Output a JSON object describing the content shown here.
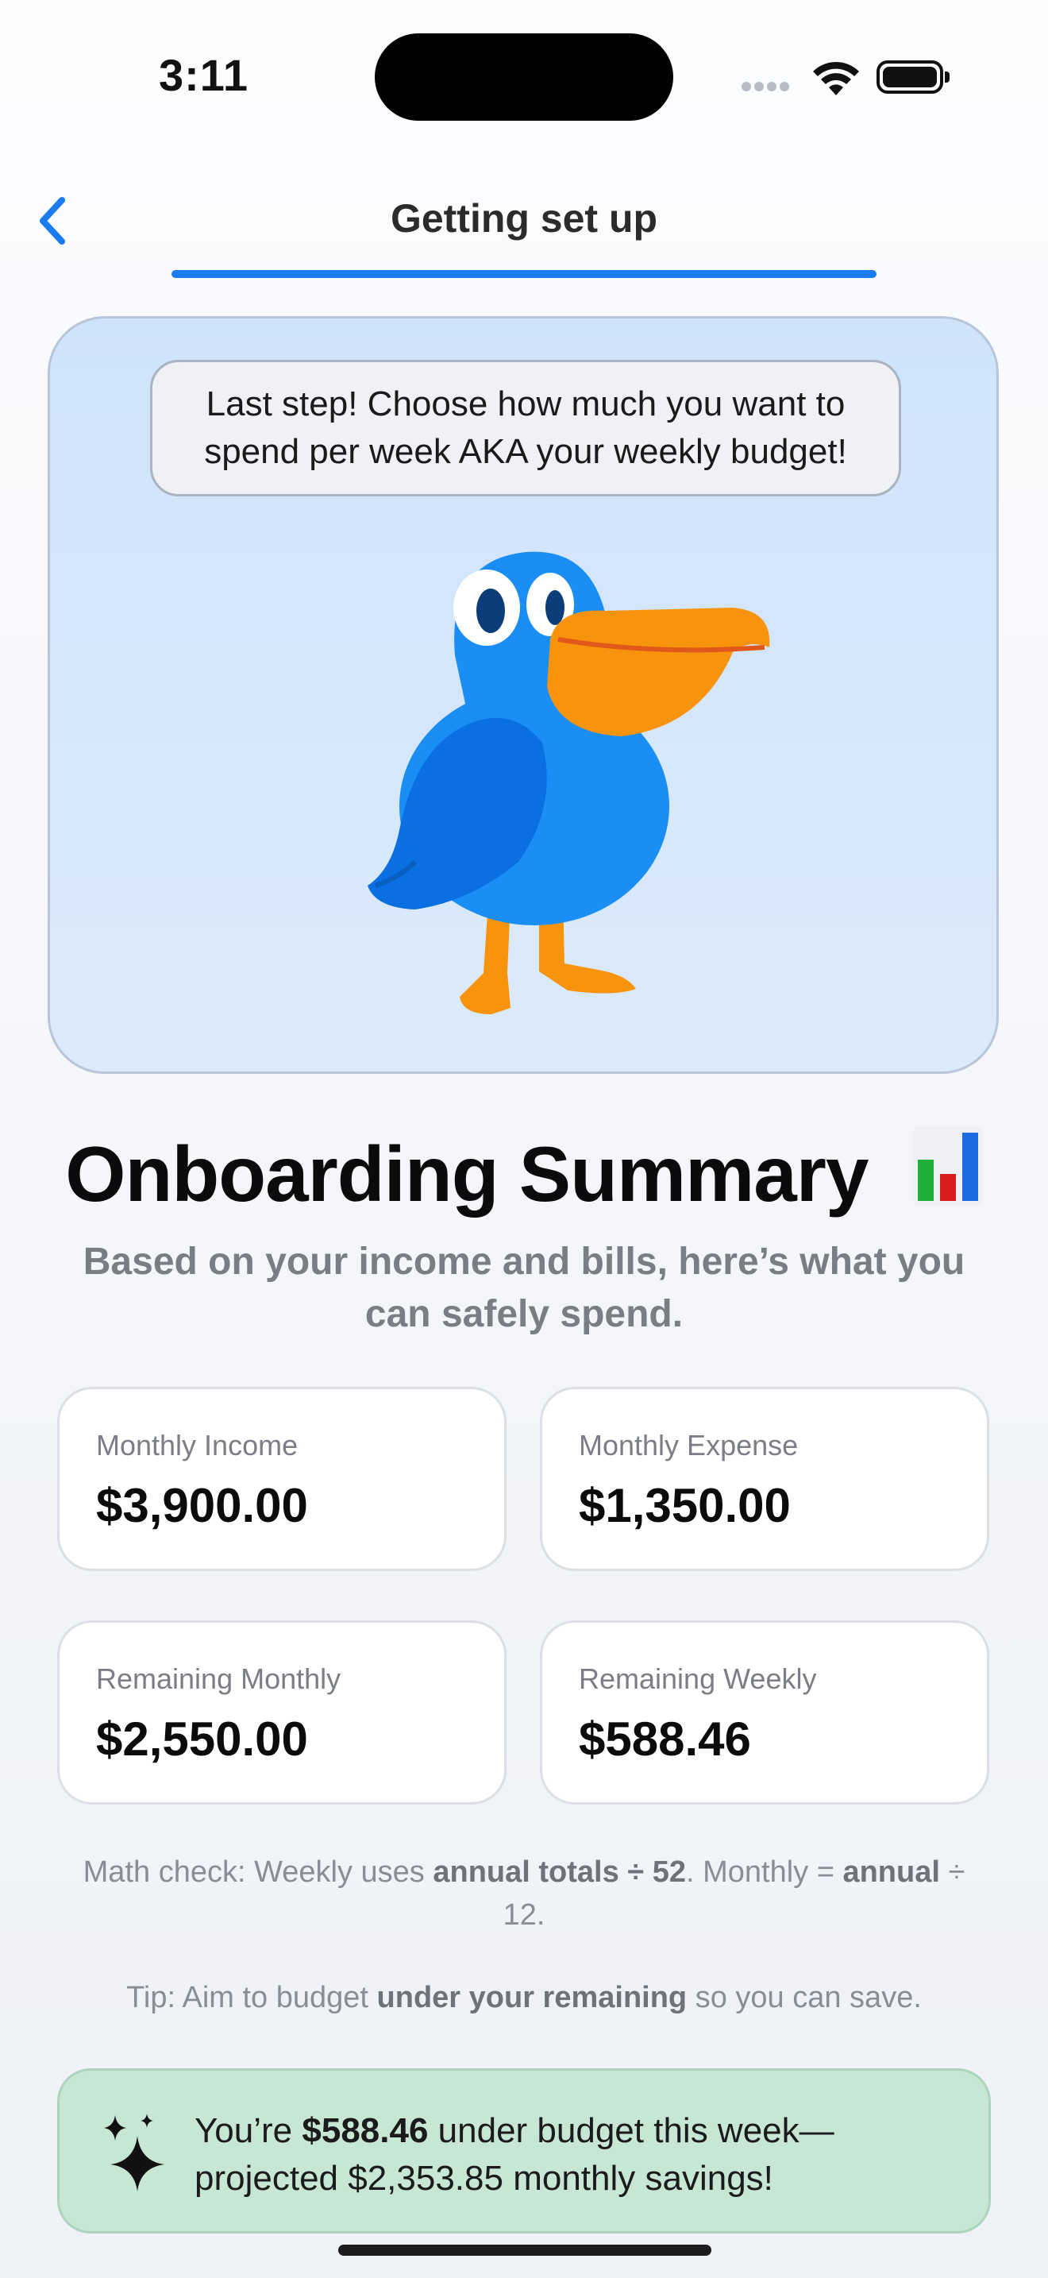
{
  "status_bar": {
    "time": "3:11"
  },
  "nav": {
    "title": "Getting set up",
    "progress": 1.0
  },
  "hero": {
    "speech": "Last step! Choose how much you want to spend per week AKA your weekly budget!"
  },
  "summary": {
    "title": "Onboarding Summary",
    "subtitle": "Based on your income and bills, here’s what you can safely spend."
  },
  "cards": [
    {
      "label": "Monthly Income",
      "value": "$3,900.00"
    },
    {
      "label": "Monthly Expense",
      "value": "$1,350.00"
    },
    {
      "label": "Remaining Monthly",
      "value": "$2,550.00"
    },
    {
      "label": "Remaining Weekly",
      "value": "$588.46"
    }
  ],
  "math_check": {
    "prefix": "Math check: Weekly uses ",
    "bold1": "annual totals ÷ 52",
    "middle": ". Monthly = ",
    "bold2": "annual",
    "suffix": " ÷ 12."
  },
  "tip": {
    "prefix": "Tip: Aim to budget ",
    "bold": "under your remaining",
    "suffix": " so you can save."
  },
  "banner": {
    "prefix": "You’re ",
    "amount": "$588.46",
    "suffix": " under budget this week—projected $2,353.85 monthly savings!"
  },
  "colors": {
    "accent": "#1a7cf0",
    "banner_bg": "#c7e6d3",
    "hero_bg": "#cfe3fb",
    "mascot_body": "#1a8ef5",
    "mascot_beak": "#f7930c"
  },
  "icons": {
    "back": "chevron-left-icon",
    "sparkle": "sparkles-icon",
    "chart": "bar-chart-icon"
  }
}
